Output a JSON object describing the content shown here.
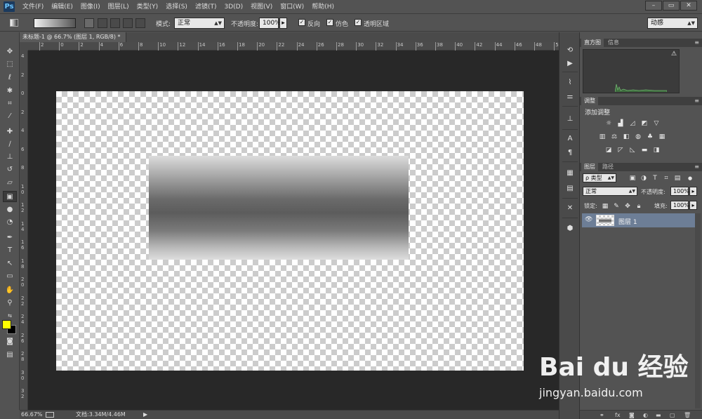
{
  "app": {
    "logo": "Ps"
  },
  "menu": [
    "文件(F)",
    "编辑(E)",
    "图像(I)",
    "图层(L)",
    "类型(Y)",
    "选择(S)",
    "滤镜(T)",
    "3D(D)",
    "视图(V)",
    "窗口(W)",
    "帮助(H)"
  ],
  "window_controls": {
    "minimize": "–",
    "restore": "▭",
    "close": "✕"
  },
  "options": {
    "mode_label": "模式:",
    "mode_value": "正常",
    "opacity_label": "不透明度:",
    "opacity_value": "100%",
    "reverse_label": "反向",
    "dither_label": "仿色",
    "transparency_label": "透明区域",
    "workspace_value": "动感"
  },
  "document": {
    "tab_title": "未标题-1 @ 66.7% (图层 1, RGB/8) *",
    "gradient_colors": [
      "#dcdcdc",
      "#5c5c5c",
      "#dedede"
    ]
  },
  "ruler": {
    "h_labels": [
      "2",
      "0",
      "2",
      "4",
      "6",
      "8",
      "10",
      "12",
      "14",
      "16",
      "18",
      "20",
      "22",
      "24",
      "26",
      "28",
      "30",
      "32",
      "34",
      "36",
      "38",
      "40",
      "42",
      "44",
      "46",
      "48",
      "50"
    ],
    "v_labels": [
      "4",
      "2",
      "0",
      "2",
      "4",
      "6",
      "8",
      "1 0",
      "1 2",
      "1 4",
      "1 6",
      "1 8",
      "2 0",
      "2 2",
      "2 4",
      "2 6",
      "2 8",
      "3 0",
      "3 2"
    ]
  },
  "status": {
    "zoom": "66.67%",
    "doc_info": "文档:3.34M/4.46M"
  },
  "colors": {
    "foreground": "#ffff00",
    "background": "#000000"
  },
  "panels": {
    "histogram_tab": "直方图",
    "info_tab": "信息",
    "adjustments_tab": "调整",
    "adjustments_title": "添加调整",
    "layers_tab": "图层",
    "paths_tab": "路径",
    "kind_filter": "ρ 类型",
    "blend_mode": "正常",
    "opacity_label": "不透明度:",
    "opacity_value": "100%",
    "lock_label": "锁定:",
    "fill_label": "填充:",
    "fill_value": "100%",
    "layer_name": "图层 1"
  },
  "watermark": {
    "logo": "Bai du 经验",
    "url": "jingyan.baidu.com"
  }
}
